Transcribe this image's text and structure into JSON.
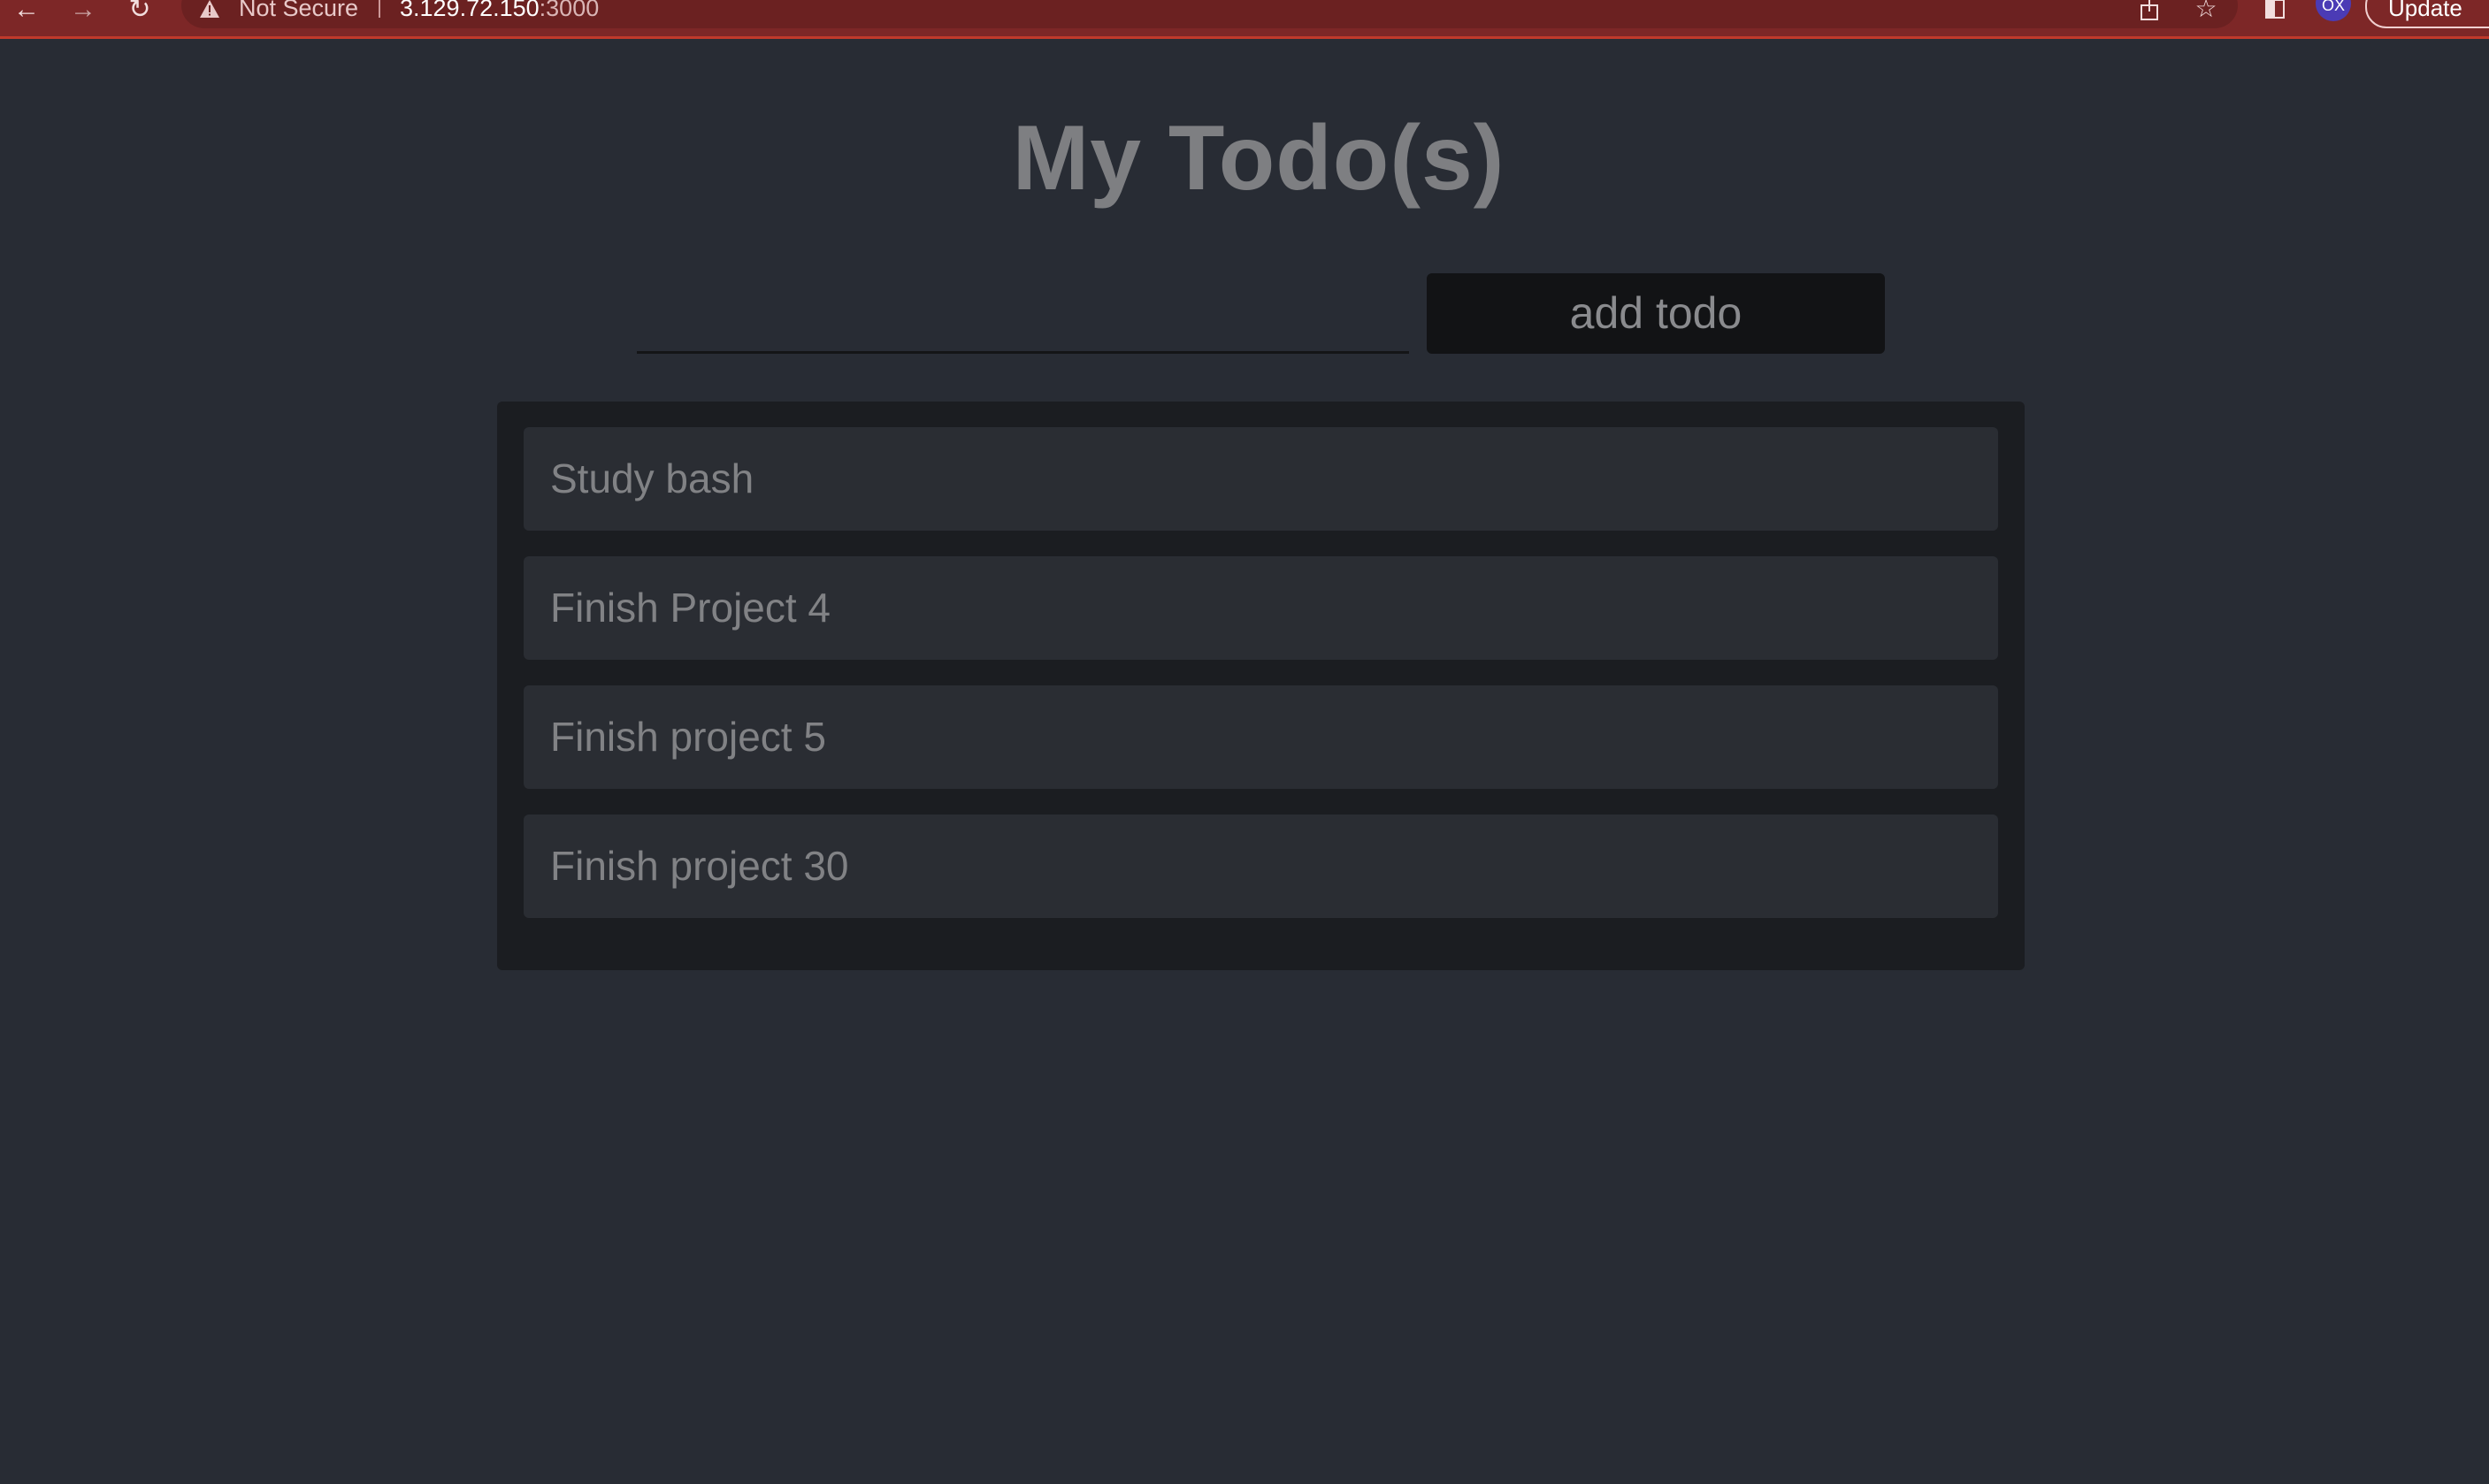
{
  "browser": {
    "security_label": "Not Secure",
    "url_host": "3.129.72.150",
    "url_port": ":3000",
    "profile_initials": "OX",
    "update_label": "Update",
    "back_icon": "arrow-left-icon",
    "forward_icon": "arrow-right-icon",
    "reload_icon": "reload-icon",
    "share_icon": "share-icon",
    "bookmark_icon": "star-icon",
    "sidebar_icon": "side-panel-icon",
    "warning_icon": "warning-triangle-icon",
    "colors": {
      "toolbar": "#7d2727",
      "accent_line": "#c0392b",
      "avatar": "#4b3bb5"
    }
  },
  "app": {
    "title": "My Todo(s)",
    "input": {
      "value": "",
      "placeholder": ""
    },
    "add_button_label": "add todo",
    "todos": [
      {
        "text": "Study bash"
      },
      {
        "text": "Finish Project 4"
      },
      {
        "text": "Finish project 5"
      },
      {
        "text": "Finish project 30"
      }
    ],
    "colors": {
      "background": "#282c34",
      "list_panel": "#1b1d21",
      "item": "#2a2d33",
      "button": "#121315",
      "text": "#818285"
    }
  }
}
